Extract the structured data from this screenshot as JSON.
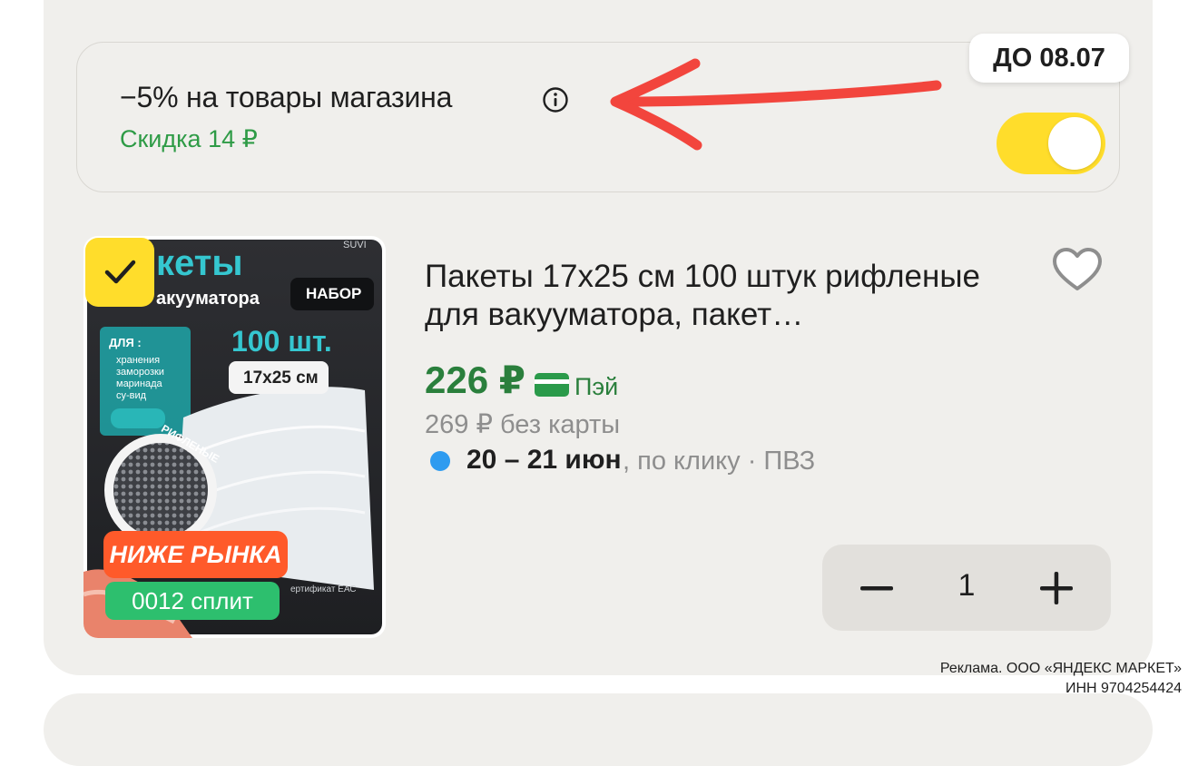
{
  "promo": {
    "title": "−5% на товары магазина",
    "discount": "Скидка 14 ₽",
    "until": "ДО 08.07",
    "toggle_on": true,
    "accent_color": "#ffdd2b"
  },
  "product": {
    "selected": true,
    "image": {
      "brand": "SUVI",
      "headline_1": "кеты",
      "headline_2": "акууматора",
      "set_label": "НАБОР",
      "count": "100 шт.",
      "size": "17x25 см",
      "for_label": "ДЛЯ :",
      "uses": [
        "хранения",
        "заморозки",
        "маринада",
        "су-вид"
      ],
      "texture_label": "РИФЛЕНЫЕ",
      "cert": "ертификат ЕАС"
    },
    "badge_below_market": "НИЖЕ РЫНКА",
    "badge_split": "0012 сплит",
    "title": "Пакеты 17х25 см 100 штук рифленые для вакууматора, пакет…",
    "price": "226 ₽",
    "pay_label": "Пэй",
    "old_price": "269 ₽ без карты",
    "delivery_date": "20 – 21 июн",
    "delivery_rest": ", по клику · ПВЗ",
    "quantity": "1"
  },
  "ad": {
    "line1": "Реклама. ООО «ЯНДЕКС МАРКЕТ»",
    "line2": "ИНН 9704254424"
  }
}
